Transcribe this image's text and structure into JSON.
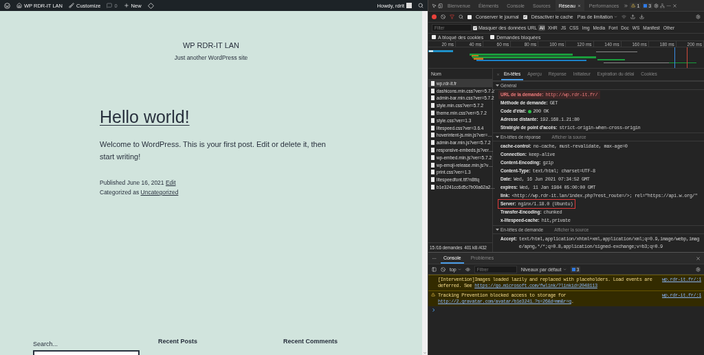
{
  "admin_bar": {
    "items": [
      {
        "kind": "site",
        "label": "WP RDR-IT LAN"
      },
      {
        "kind": "customize",
        "label": "Customize"
      },
      {
        "kind": "comments",
        "label": "0"
      },
      {
        "kind": "new",
        "label": "New"
      },
      {
        "kind": "plugin"
      }
    ],
    "howdy": "Howdy, rdrit"
  },
  "site": {
    "title": "WP RDR-IT LAN",
    "tagline": "Just another WordPress site"
  },
  "post": {
    "title": "Hello world!",
    "body": "Welcome to WordPress. This is your first post. Edit or delete it, then start writing!",
    "published": "Published June 16, 2021",
    "edit": "Edit",
    "categorized": "Categorized as",
    "category": "Uncategorized"
  },
  "widgets": {
    "search_label": "Search...",
    "recent_posts": "Recent Posts",
    "recent_comments": "Recent Comments"
  },
  "devtools": {
    "tabs": [
      {
        "label": "Bienvenue",
        "selected": false
      },
      {
        "label": "Éléments",
        "selected": false
      },
      {
        "label": "Console",
        "selected": false
      },
      {
        "label": "Sources",
        "selected": false
      },
      {
        "label": "Réseau",
        "selected": true
      },
      {
        "label": "Performances",
        "selected": false
      }
    ],
    "warnings": "1",
    "messages": "3",
    "preserve_log": {
      "label": "Conserver le journal",
      "checked": false
    },
    "disable_cache": {
      "label": "Désactiver le cache",
      "checked": true
    },
    "throttling": "Pas de limitation",
    "filter_placeholder": "Filter",
    "hide_data_urls": {
      "label": "Masquer des données URL",
      "checked": true
    },
    "types": [
      {
        "label": "All",
        "selected": true
      },
      {
        "label": "XHR",
        "selected": false
      },
      {
        "label": "JS",
        "selected": false
      },
      {
        "label": "CSS",
        "selected": false
      },
      {
        "label": "Img",
        "selected": false
      },
      {
        "label": "Media",
        "selected": false
      },
      {
        "label": "Font",
        "selected": false
      },
      {
        "label": "Doc",
        "selected": false
      },
      {
        "label": "WS",
        "selected": false
      },
      {
        "label": "Manifest",
        "selected": false
      },
      {
        "label": "Other",
        "selected": false
      }
    ],
    "blocked_cookies": {
      "label": "A bloqué des cookies",
      "checked": false
    },
    "blocked_requests": {
      "label": "Demandes bloquées",
      "checked": false
    },
    "ticks": [
      "20 ms",
      "40 ms",
      "60 ms",
      "80 ms",
      "100 ms",
      "120 ms",
      "140 ms",
      "160 ms",
      "180 ms",
      "200 ms"
    ],
    "list_header": "Nom",
    "requests": [
      {
        "name": "wp.rdr-it.fr",
        "selected": true
      },
      {
        "name": "dashicons.min.css?ver=5.7.2",
        "selected": false
      },
      {
        "name": "admin-bar.min.css?ver=5.7.2",
        "selected": false
      },
      {
        "name": "style.min.css?ver=5.7.2",
        "selected": false
      },
      {
        "name": "theme.min.css?ver=5.7.2",
        "selected": false
      },
      {
        "name": "style.css?ver=1.3",
        "selected": false
      },
      {
        "name": "litespeed.css?ver=3.6.4",
        "selected": false
      },
      {
        "name": "hoverintent-js.min.js?ver=…",
        "selected": false
      },
      {
        "name": "admin-bar.min.js?ver=5.7.2",
        "selected": false
      },
      {
        "name": "responsive-embeds.js?ver…",
        "selected": false
      },
      {
        "name": "wp-embed.min.js?ver=5.7.2",
        "selected": false
      },
      {
        "name": "wp-emoji-release.min.js?v…",
        "selected": false
      },
      {
        "name": "print.css?ver=1.3",
        "selected": false
      },
      {
        "name": "litespeedfont.ttf?n8ttq",
        "selected": false
      },
      {
        "name": "b1e3241cc6d5c7b00a62a2…",
        "selected": false
      }
    ],
    "status": [
      "15 /16 demandes",
      "401 kB /432"
    ],
    "detail_tabs": [
      {
        "label": "En-têtes",
        "selected": true
      },
      {
        "label": "Aperçu",
        "selected": false
      },
      {
        "label": "Réponse",
        "selected": false
      },
      {
        "label": "Initiateur",
        "selected": false
      },
      {
        "label": "Expiration du délai",
        "selected": false
      },
      {
        "label": "Cookies",
        "selected": false
      }
    ],
    "sections": [
      {
        "title": "Général",
        "expanded": true,
        "rows": [
          {
            "name": "URL de la demande:",
            "value": "http://wp.rdr-it.fr/",
            "kind": "highlight"
          },
          {
            "name": "Méthode de demande:",
            "value": "GET",
            "kind": "plain"
          },
          {
            "name": "Code d'état:",
            "value": "200 OK",
            "kind": "status"
          },
          {
            "name": "Adresse distante:",
            "value": "192.168.1.21:80",
            "kind": "plain"
          },
          {
            "name": "Stratégie de point d'accès:",
            "value": "strict-origin-when-cross-origin",
            "kind": "plain"
          }
        ]
      },
      {
        "title": "En-têtes de réponse",
        "action": "Afficher la source",
        "expanded": true,
        "rows": [
          {
            "name": "cache-control:",
            "value": "no-cache, must-revalidate, max-age=0",
            "kind": "plain"
          },
          {
            "name": "Connection:",
            "value": "keep-alive",
            "kind": "plain"
          },
          {
            "name": "Content-Encoding:",
            "value": "gzip",
            "kind": "plain"
          },
          {
            "name": "Content-Type:",
            "value": "text/html; charset=UTF-8",
            "kind": "plain"
          },
          {
            "name": "Date:",
            "value": "Wed, 16 Jun 2021 07:34:52 GMT",
            "kind": "plain"
          },
          {
            "name": "expires:",
            "value": "Wed, 11 Jan 1984 05:00:00 GMT",
            "kind": "plain"
          },
          {
            "name": "link:",
            "value": "<http://wp.rdr-it.lan/index.php?rest_route=/>; rel=\"https://api.w.org/\"",
            "kind": "plain"
          },
          {
            "name": "Server:",
            "value": "nginx/1.18.0 (Ubuntu)",
            "kind": "outlined"
          },
          {
            "name": "Transfer-Encoding:",
            "value": "chunked",
            "kind": "plain"
          },
          {
            "name": "x-litespeed-cache:",
            "value": "hit,private",
            "kind": "plain"
          }
        ]
      },
      {
        "title": "En-têtes de demande",
        "action": "Afficher la source",
        "expanded": true,
        "rows": [
          {
            "name": "Accept:",
            "value": "text/html,application/xhtml+xml,application/xml;q=0.9,image/webp,image/apng,*/*;q=0.8,application/signed-exchange;v=b3;q=0.9",
            "kind": "plain"
          }
        ]
      }
    ]
  },
  "console": {
    "tabs": [
      {
        "label": "Console",
        "selected": true
      },
      {
        "label": "Problèmes",
        "selected": false
      }
    ],
    "context": "top",
    "filter_placeholder": "Filtrer",
    "levels": "Niveaux par défaut",
    "badge": "3",
    "messages": [
      {
        "kind": "info",
        "text": "[Intervention]Images loaded lazily and replaced with placeholders. Load events are deferred. See ",
        "link": "https://go.microsoft.com/fwlink/?linkid=2048113",
        "source": "wp.rdr-it.fr/:1"
      },
      {
        "kind": "warning",
        "text": "Tracking Prevention blocked access to storage for ",
        "link": "http://2.gravatar.com/avatar/b1e3241…?s=26&d=mm&r=g",
        "after": ".",
        "source": "wp.rdr-it.fr/:1"
      }
    ]
  }
}
